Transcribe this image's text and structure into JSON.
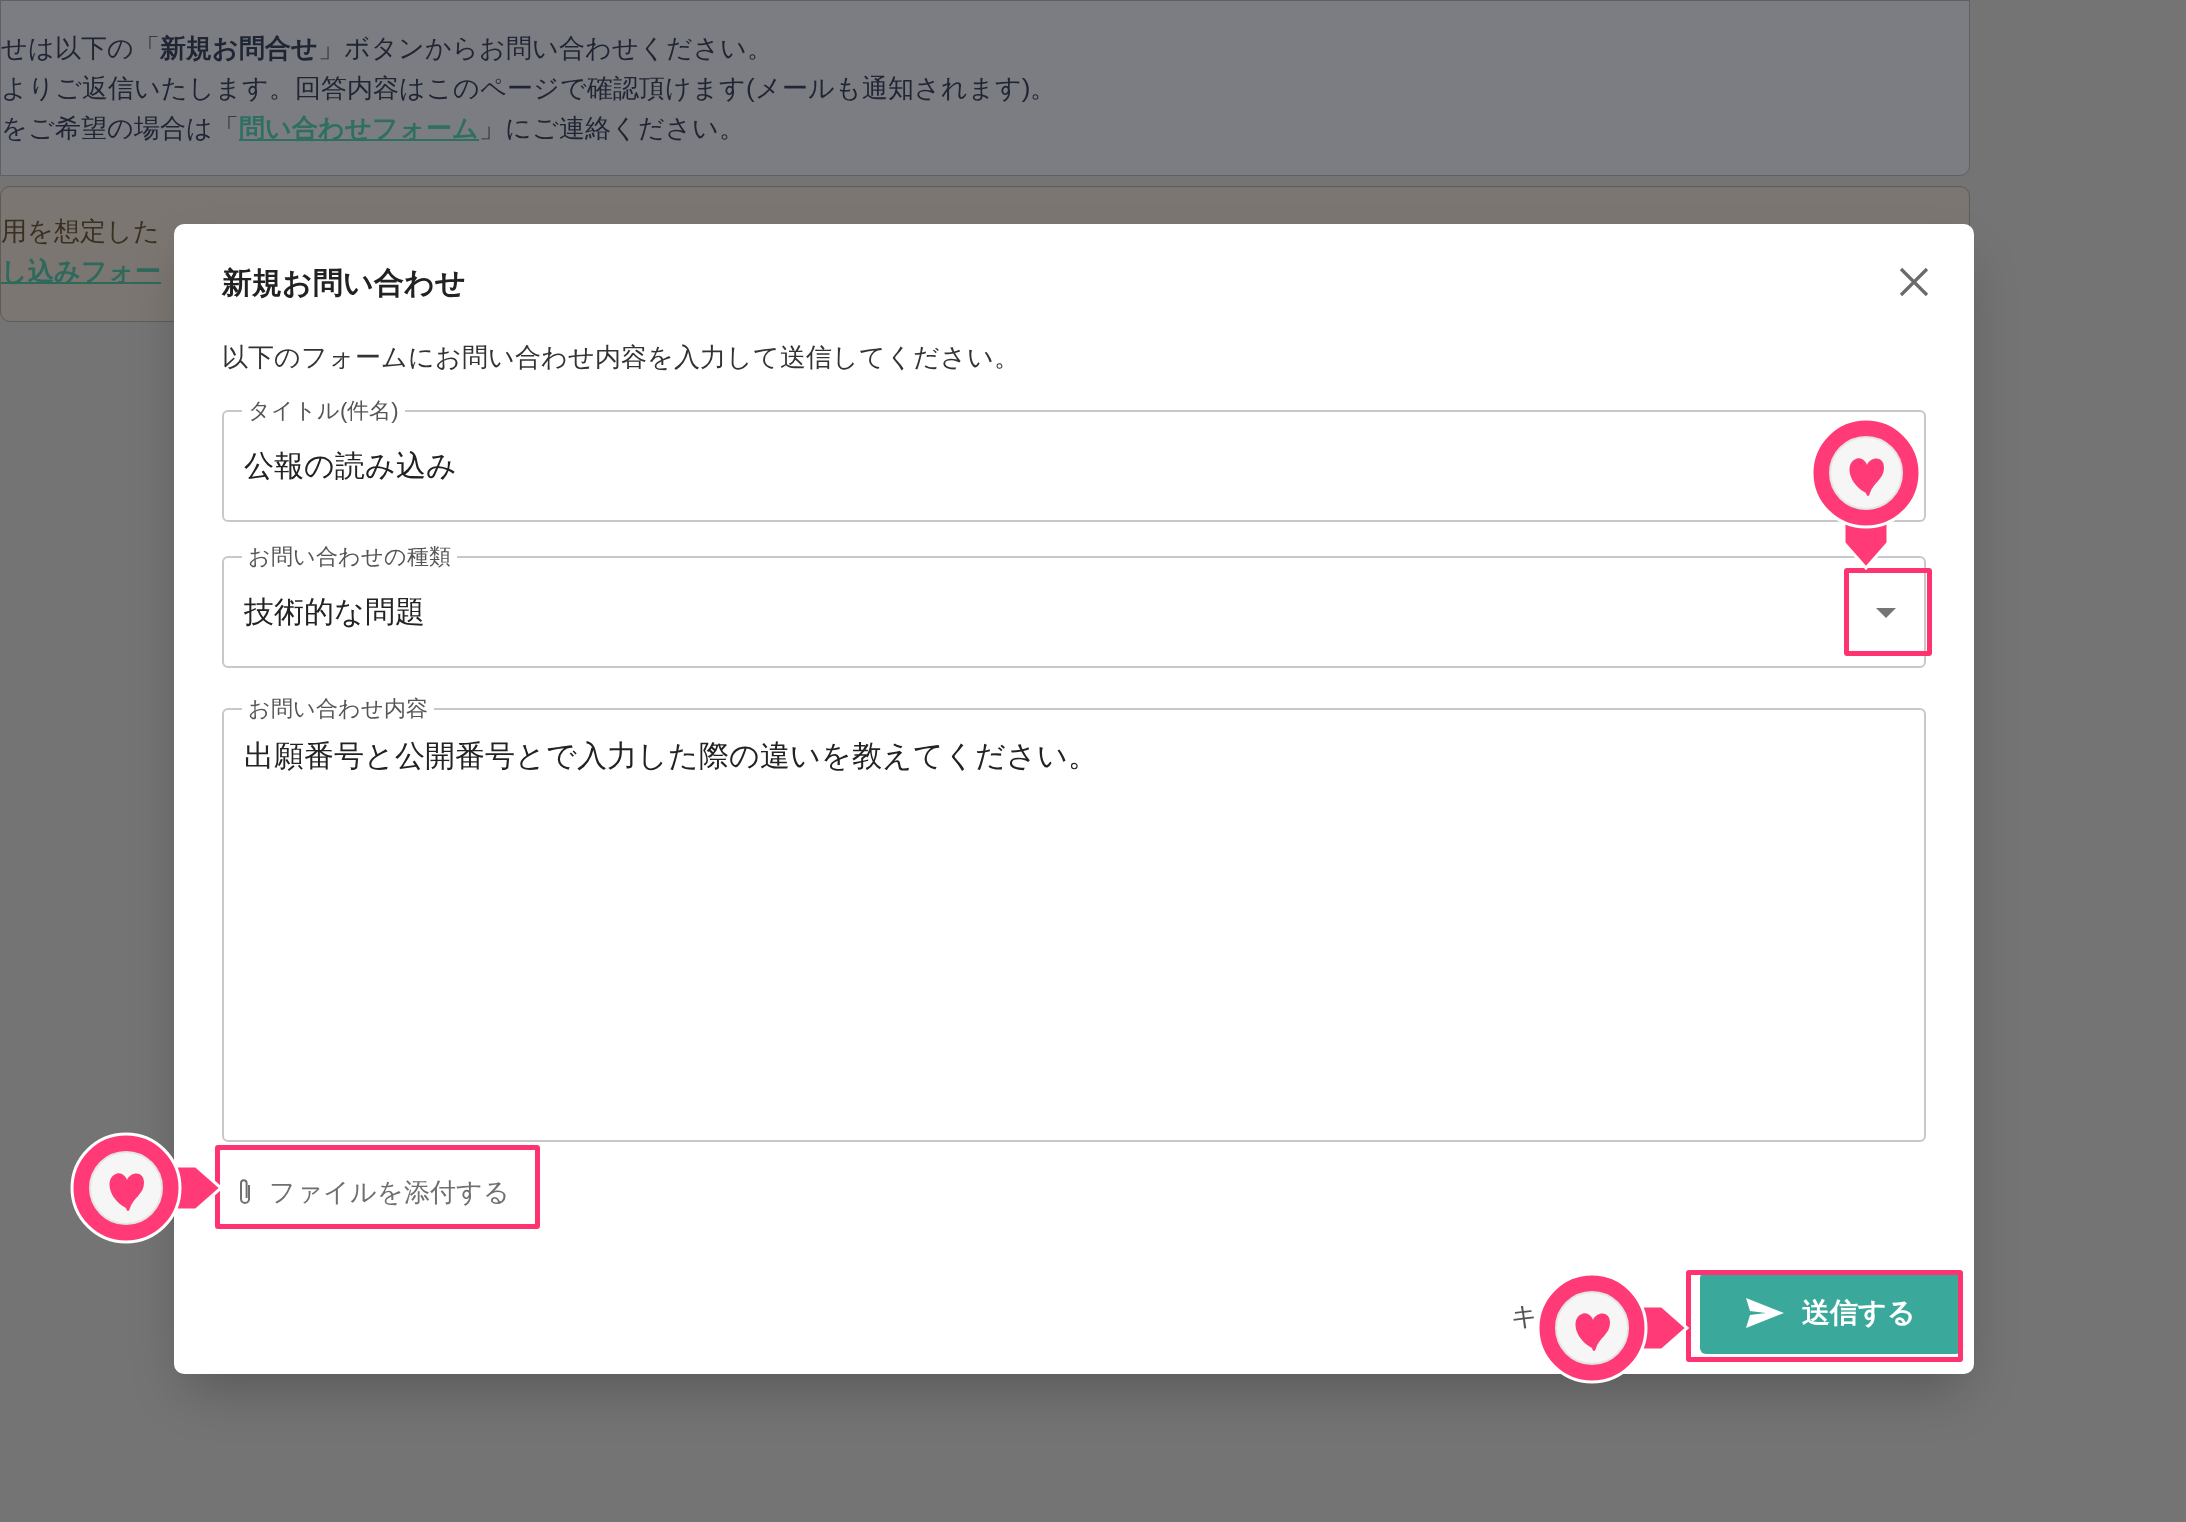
{
  "background": {
    "notice_lines": [
      {
        "text": "せは以下の「**新規お問合せ**」ボタンからお問い合わせください。"
      },
      {
        "text": "よりご返信いたします。回答内容はこのページで確認頂けます(メールも通知されます)。"
      },
      {
        "text": "をご希望の場合は「",
        "link": "問い合わせフォーム",
        "after": "」にご連絡ください。"
      }
    ],
    "info_lines": [
      {
        "text": "用を想定した"
      },
      {
        "link": "し込みフォー"
      }
    ]
  },
  "dialog": {
    "title": "新規お問い合わせ",
    "description": "以下のフォームにお問い合わせ内容を入力して送信してください。",
    "fields": [
      {
        "kind": "text",
        "label": "タイトル(件名)",
        "value": "公報の読み込み"
      },
      {
        "kind": "select",
        "label": "お問い合わせの種類",
        "value": "技術的な問題"
      },
      {
        "kind": "textarea",
        "label": "お問い合わせ内容",
        "value": "出願番号と公開番号とで入力した際の違いを教えてください。"
      }
    ],
    "attach_label": "ファイルを添付する",
    "cancel_label": "キ",
    "submit_label": "送信する"
  }
}
